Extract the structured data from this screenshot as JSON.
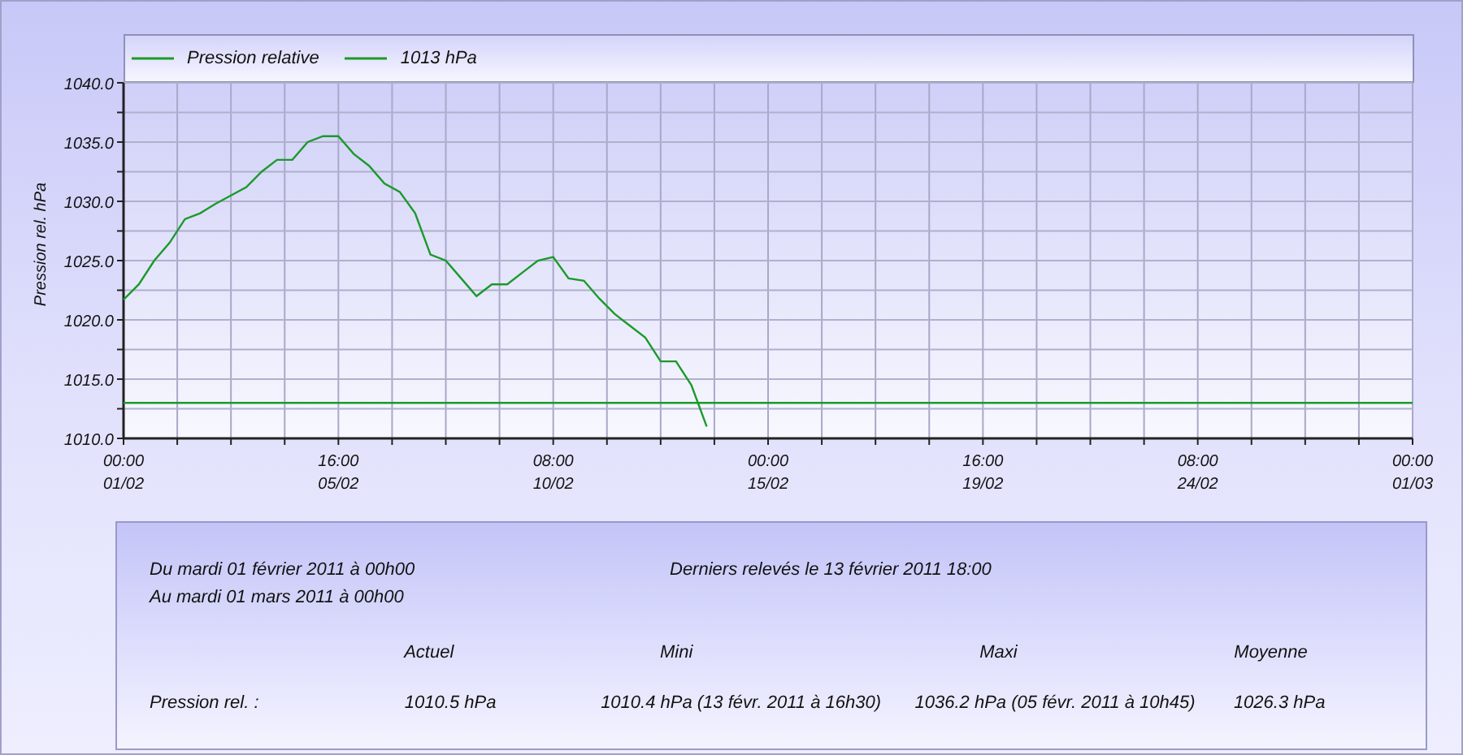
{
  "chart": {
    "chart_data": {
      "type": "line",
      "ylabel": "Pression rel. hPa",
      "grid": true,
      "categories": [
        "00:00\n01/02",
        null,
        null,
        null,
        null,
        null,
        null,
        null,
        null,
        null,
        null,
        null,
        null,
        null,
        "16:00\n05/02",
        null,
        null,
        null,
        null,
        null,
        null,
        null,
        null,
        null,
        null,
        null,
        null,
        null,
        "08:00\n10/02",
        null,
        null,
        null,
        null,
        null,
        null,
        null,
        null,
        null,
        null,
        null,
        null,
        null,
        "00:00\n15/02",
        null,
        null,
        null,
        null,
        null,
        null,
        null,
        null,
        null,
        null,
        null,
        null,
        null,
        "16:00\n19/02",
        null,
        null,
        null,
        null,
        null,
        null,
        null,
        null,
        null,
        null,
        null,
        null,
        null,
        "08:00\n24/02",
        null,
        null,
        null,
        null,
        null,
        null,
        null,
        null,
        null,
        null,
        null,
        null,
        null,
        "00:00\n01/03"
      ],
      "series": [
        {
          "name": "Pression relative",
          "color": "#1a9a2a",
          "values": [
            1021.7,
            1023,
            1025,
            1026.5,
            1028.5,
            1029,
            1029.8,
            1030.5,
            1031.2,
            1032.5,
            1033.5,
            1033.5,
            1035,
            1035.5,
            1035.5,
            1034,
            1033,
            1031.5,
            1030.8,
            1029,
            1025.5,
            1025,
            1023.5,
            1022,
            1023,
            1023,
            1024,
            1025,
            1025.3,
            1023.5,
            1023.3,
            1021.8,
            1020.5,
            1019.5,
            1018.5,
            1016.5,
            1016.5,
            1014.5,
            1011,
            null,
            null,
            null,
            null,
            null,
            null,
            null,
            null,
            null,
            null,
            null,
            null,
            null,
            null,
            null,
            null,
            null,
            null,
            null,
            null,
            null,
            null,
            null,
            null,
            null,
            null,
            null,
            null,
            null,
            null,
            null,
            null,
            null,
            null,
            null,
            null,
            null,
            null,
            null,
            null,
            null,
            null,
            null,
            null,
            null,
            null
          ]
        },
        {
          "name": "1013 hPa",
          "color": "#1a9a2a",
          "values": [
            1013,
            1013,
            1013,
            1013,
            1013,
            1013,
            1013,
            1013,
            1013,
            1013,
            1013,
            1013,
            1013,
            1013,
            1013,
            1013,
            1013,
            1013,
            1013,
            1013,
            1013,
            1013,
            1013,
            1013,
            1013,
            1013,
            1013,
            1013,
            1013,
            1013,
            1013,
            1013,
            1013,
            1013,
            1013,
            1013,
            1013,
            1013,
            1013,
            1013,
            1013,
            1013,
            1013,
            1013,
            1013,
            1013,
            1013,
            1013,
            1013,
            1013,
            1013,
            1013,
            1013,
            1013,
            1013,
            1013,
            1013,
            1013,
            1013,
            1013,
            1013,
            1013,
            1013,
            1013,
            1013,
            1013,
            1013,
            1013,
            1013,
            1013,
            1013,
            1013,
            1013,
            1013,
            1013,
            1013,
            1013,
            1013,
            1013,
            1013,
            1013,
            1013,
            1013,
            1013,
            1013
          ]
        }
      ],
      "ylim": [
        1010,
        1040
      ],
      "yticks": [
        {
          "value": 1010,
          "label": "1010.0"
        },
        {
          "value": 1015,
          "label": "1015.0"
        },
        {
          "value": 1020,
          "label": "1020.0"
        },
        {
          "value": 1025,
          "label": "1025.0"
        },
        {
          "value": 1030,
          "label": "1030.0"
        },
        {
          "value": 1035,
          "label": "1035.0"
        },
        {
          "value": 1040,
          "label": "1040.0"
        }
      ]
    }
  },
  "summary": {
    "period": [
      "Du mardi 01 février 2011 à 00h00",
      "Au mardi 01 mars 2011 à 00h00"
    ],
    "last_reading": "Derniers relevés le 13 février 2011 18:00",
    "columns": [
      "Actuel",
      "Mini",
      "Maxi",
      "Moyenne"
    ],
    "rows": [
      {
        "label": "Pression rel. :",
        "values": [
          "1010.5 hPa",
          "1010.4 hPa (13 févr. 2011 à 16h30)",
          "1036.2 hPa (05 févr. 2011 à 10h45)",
          "1026.3 hPa"
        ]
      }
    ]
  }
}
